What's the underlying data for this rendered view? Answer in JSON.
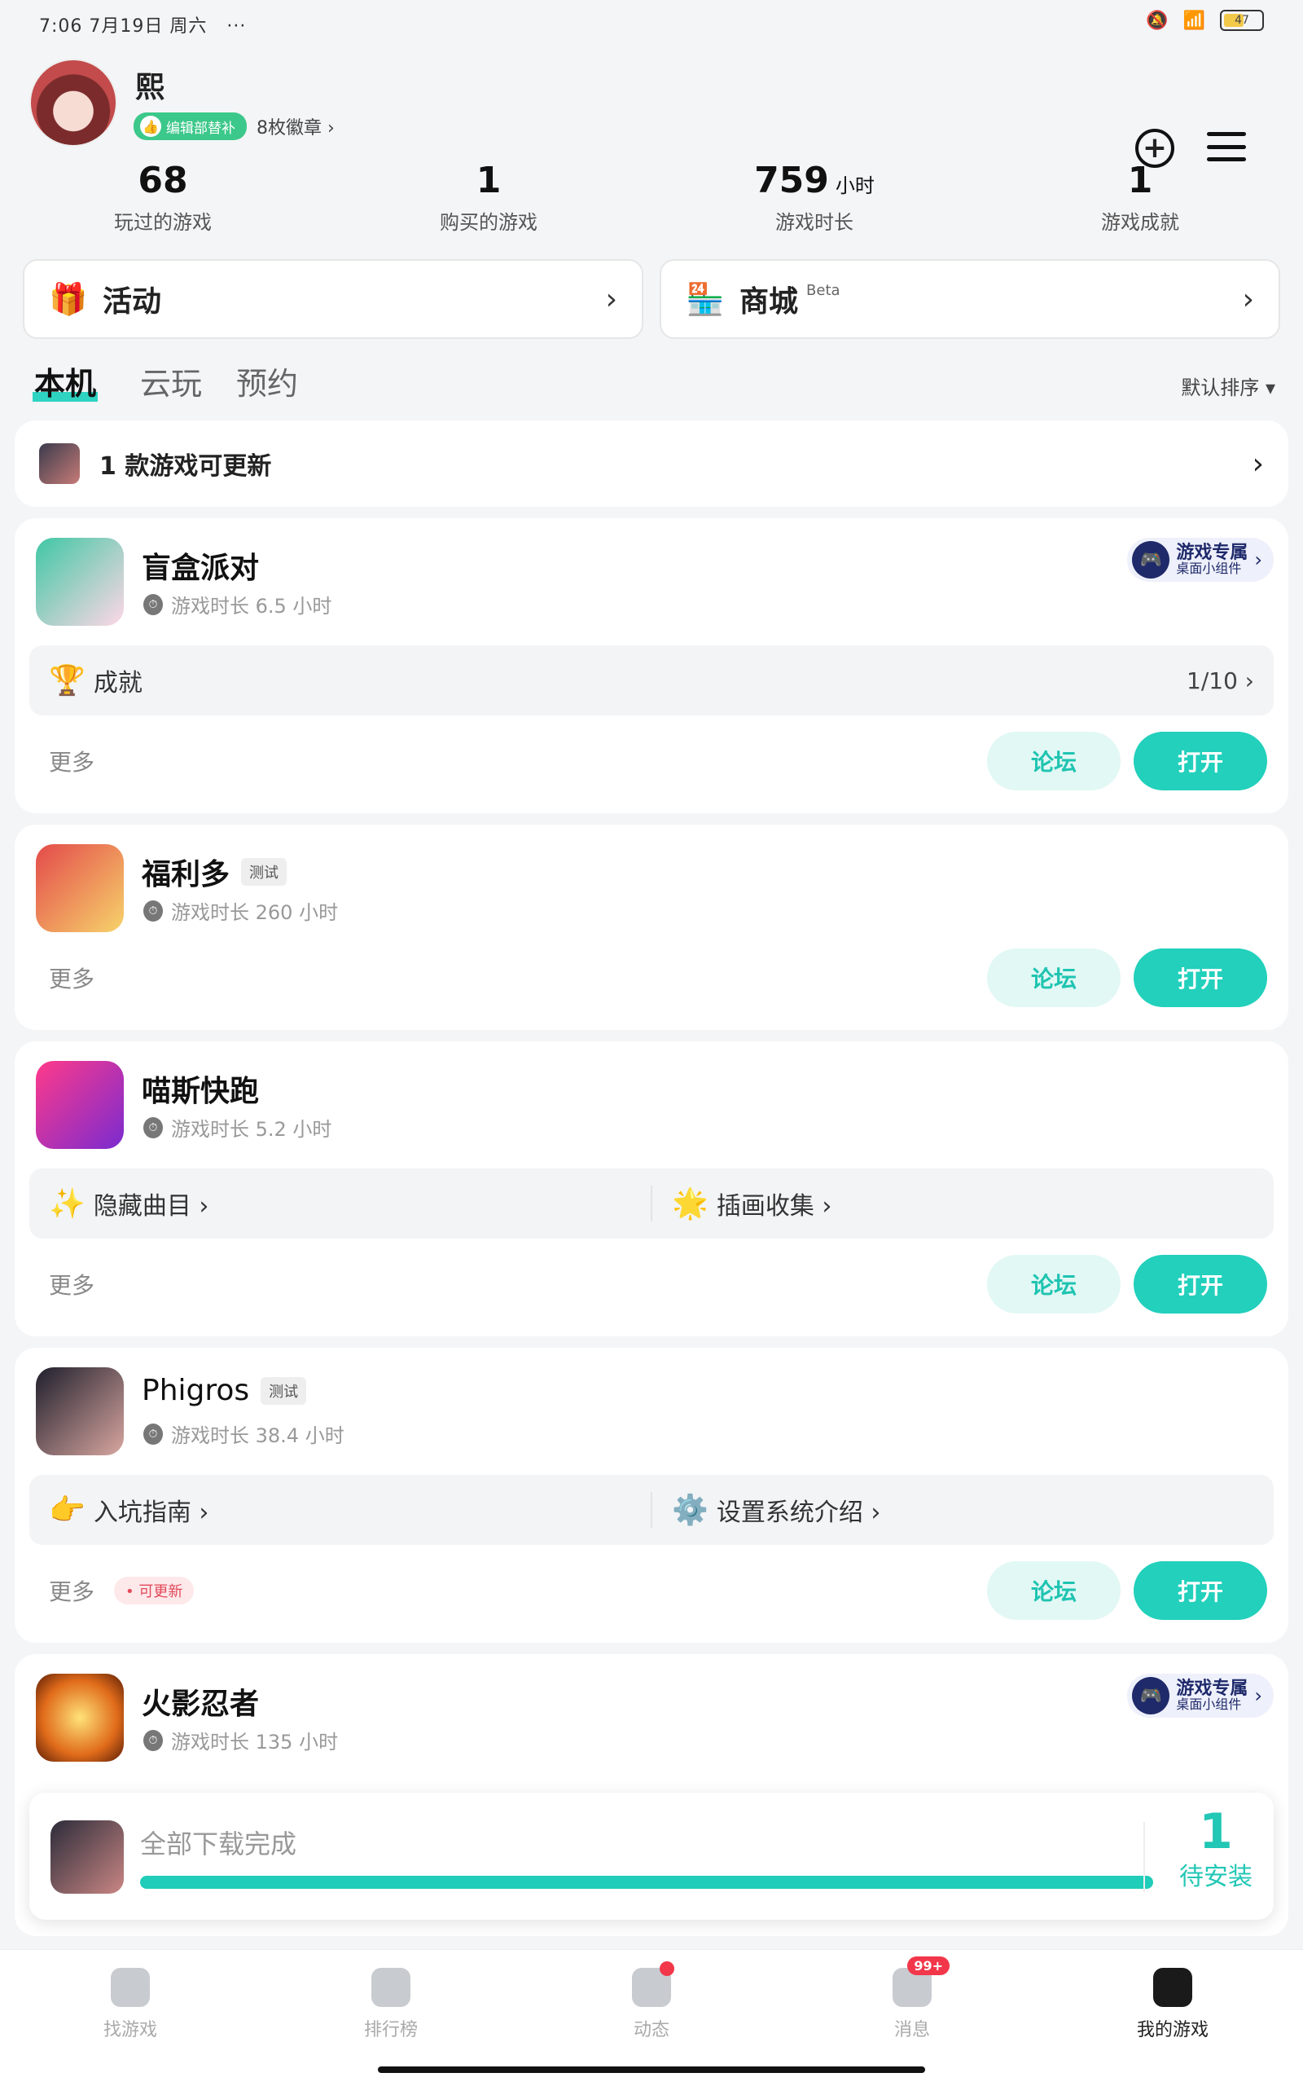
{
  "status": {
    "time_date": "7:06  7月19日  周六",
    "dots": "···",
    "battery": "47"
  },
  "profile": {
    "name": "熙",
    "badge": "编辑部替补",
    "badges_count": "8枚徽章 ›"
  },
  "stats": [
    {
      "num": "68",
      "unit": "",
      "label": "玩过的游戏"
    },
    {
      "num": "1",
      "unit": "",
      "label": "购买的游戏"
    },
    {
      "num": "759",
      "unit": "小时",
      "label": "游戏时长"
    },
    {
      "num": "1",
      "unit": "",
      "label": "游戏成就"
    }
  ],
  "quick": {
    "activity": "活动",
    "shop": "商城",
    "beta": "Beta"
  },
  "tabs": [
    "本机",
    "云玩",
    "预约"
  ],
  "sort": "默认排序 ▾",
  "update_notice": "1 款游戏可更新",
  "widget": {
    "title": "游戏专属",
    "sub": "桌面小组件"
  },
  "common": {
    "more": "更多",
    "forum": "论坛",
    "open": "打开",
    "test": "测试",
    "updatable": "• 可更新"
  },
  "games": [
    {
      "name": "盲盒派对",
      "time": "游戏时长 6.5 小时",
      "strip_left": "成就",
      "strip_right": "1/10 ›"
    },
    {
      "name": "福利多",
      "time": "游戏时长 260 小时"
    },
    {
      "name": "喵斯快跑",
      "time": "游戏时长 5.2 小时",
      "strip_left": "隐藏曲目 ›",
      "strip_right": "插画收集 ›"
    },
    {
      "name": "Phigros",
      "time": "游戏时长 38.4 小时",
      "strip_left": "入坑指南 ›",
      "strip_right": "设置系统介绍 ›"
    },
    {
      "name": "火影忍者",
      "time": "游戏时长 135 小时"
    }
  ],
  "download": {
    "text": "全部下载完成",
    "count": "1",
    "label": "待安装",
    "progress": 1.0
  },
  "nav": [
    {
      "label": "找游戏"
    },
    {
      "label": "排行榜"
    },
    {
      "label": "动态"
    },
    {
      "label": "消息",
      "badge": "99+"
    },
    {
      "label": "我的游戏"
    }
  ],
  "colors": {
    "accent": "#22d0bc",
    "widget": "#1f2a6b",
    "badge_green": "#3cc88a",
    "alert": "#f2374a"
  }
}
